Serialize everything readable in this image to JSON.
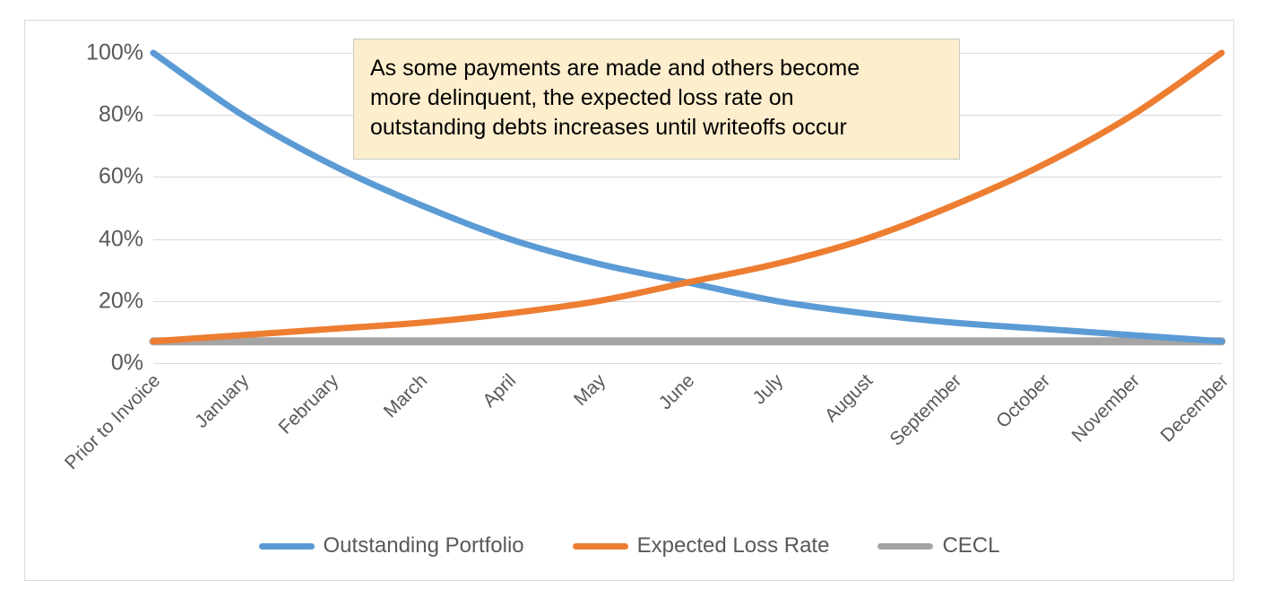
{
  "chart_data": {
    "type": "line",
    "title": "",
    "xlabel": "",
    "ylabel": "",
    "ylim": [
      0,
      100
    ],
    "y_tick_labels": [
      "0%",
      "20%",
      "40%",
      "60%",
      "80%",
      "100%"
    ],
    "y_tick_values": [
      0,
      20,
      40,
      60,
      80,
      100
    ],
    "grid": true,
    "legend_position": "bottom",
    "categories": [
      "Prior to Invoice",
      "January",
      "February",
      "March",
      "April",
      "May",
      "June",
      "July",
      "August",
      "September",
      "October",
      "November",
      "December"
    ],
    "series": [
      {
        "name": "Outstanding Portfolio",
        "color": "#5B9BD5",
        "values": [
          100,
          80,
          64,
          51,
          40,
          32,
          26,
          20,
          16,
          13,
          11,
          9,
          7
        ]
      },
      {
        "name": "Expected Loss Rate",
        "color": "#ED7D31",
        "values": [
          7,
          9,
          11,
          13,
          16,
          20,
          26,
          32,
          40,
          51,
          64,
          80,
          100
        ]
      },
      {
        "name": "CECL",
        "color": "#A5A5A5",
        "values": [
          7,
          7,
          7,
          7,
          7,
          7,
          7,
          7,
          7,
          7,
          7,
          7,
          7
        ]
      }
    ],
    "annotation": {
      "text": "As some payments are made and others become more delinquent, the expected loss rate on outstanding debts increases until writeoffs occur",
      "lines": [
        "As some payments are made and others become",
        "more delinquent, the expected loss rate on",
        "outstanding debts increases until writeoffs occur"
      ],
      "background_color": "#FDEECD",
      "border_color": "#C8C8C8"
    }
  }
}
